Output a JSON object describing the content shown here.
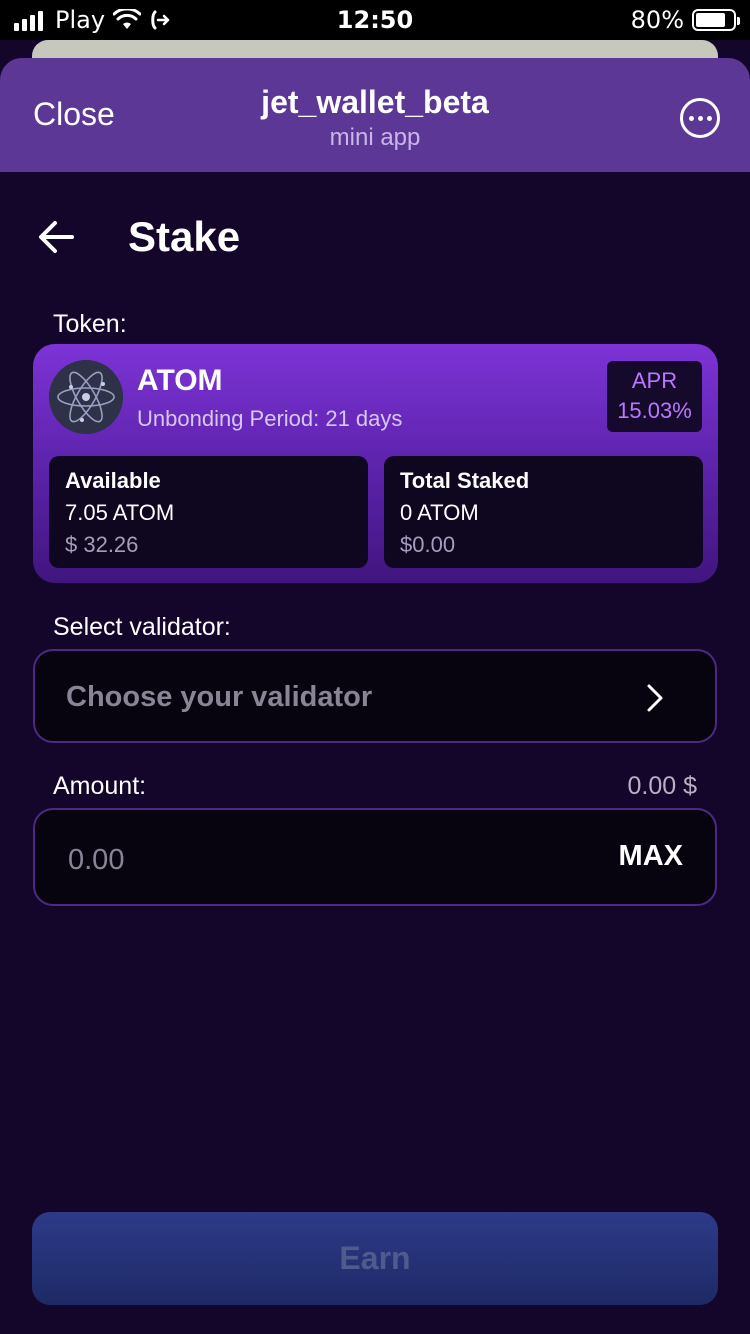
{
  "status_bar": {
    "carrier": "Play",
    "time": "12:50",
    "battery_percent": "80%",
    "battery_level": 0.8
  },
  "header": {
    "close_label": "Close",
    "title": "jet_wallet_beta",
    "subtitle": "mini app"
  },
  "page": {
    "title": "Stake"
  },
  "token_section": {
    "label": "Token:",
    "token": {
      "name": "ATOM",
      "unbonding": "Unbonding Period: 21 days",
      "apr_label": "APR",
      "apr_value": "15.03%"
    },
    "available": {
      "title": "Available",
      "amount": "7.05 ATOM",
      "usd": "$ 32.26"
    },
    "total_staked": {
      "title": "Total Staked",
      "amount": "0 ATOM",
      "usd": "$0.00"
    }
  },
  "validator_section": {
    "label": "Select validator:",
    "placeholder": "Choose your validator"
  },
  "amount_section": {
    "label": "Amount:",
    "usd_value": "0.00 $",
    "placeholder": "0.00",
    "max_label": "MAX"
  },
  "earn_button": {
    "label": "Earn"
  },
  "colors": {
    "background": "#14062b",
    "header": "#5c3795",
    "card_gradient_top": "#7d33d6",
    "apr_text": "#b878ff",
    "earn_button": "#2d3a88"
  }
}
